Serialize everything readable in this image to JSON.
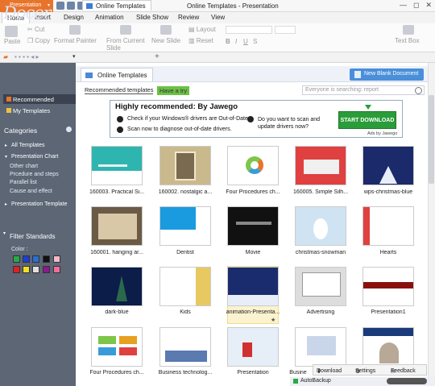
{
  "app": {
    "badge": "Presentation",
    "window_title": "Online Templates - Presentation"
  },
  "window_controls": [
    "—",
    "◻",
    "✕"
  ],
  "menu": [
    "Home",
    "Insert",
    "Design",
    "Animation",
    "Slide Show",
    "Review",
    "View"
  ],
  "ribbon": {
    "paste": "Paste",
    "cut": "Cut",
    "copy": "Copy",
    "format_painter": "Format Painter",
    "from_current_slide": "From Current Slide",
    "new_slide": "New Slide",
    "layout": "Layout",
    "reset": "Reset",
    "text_box": "Text Box"
  },
  "doc_tab": "Online Templates",
  "sidebar": {
    "logo": "Docer",
    "items": [
      {
        "label": "Recommended",
        "color": "#e8742b",
        "selected": true
      },
      {
        "label": "My Templates",
        "color": "#f0c040",
        "selected": false
      }
    ],
    "categories_title": "Categories",
    "categories": [
      {
        "label": "All Templates",
        "sub": []
      },
      {
        "label": "Presentation Chart",
        "sub": [
          "Other chart",
          "Prcedure and steps",
          "Parallel list",
          "Cause and effect"
        ]
      },
      {
        "label": "Presentation Template",
        "sub": []
      }
    ],
    "filter_title": "Filter Standards",
    "color_label": "Color :",
    "colors": [
      "#2aa84a",
      "#1f3fd0",
      "#2b6fcf",
      "#111111",
      "#f4b8c8",
      "#e02020",
      "#f0e020",
      "#e0e0e0",
      "#8a1a8a",
      "#f06e9a"
    ]
  },
  "content": {
    "tab_title": "Online Templates",
    "new_blank": "New Blank Document",
    "recommended_tab": "Recommended templates",
    "try_tab": "Have a try",
    "search_placeholder": "Everyone is searching: report"
  },
  "ad": {
    "title": "Highly recommended: By Jawego",
    "line1": "Check if your Windows® drivers are Out-of-Date.",
    "line2": "Scan now to diagnose out-of-date drivers.",
    "question": "Do you want to scan and update drivers now?",
    "button": "START DOWNLOAD",
    "by": "Ads by Jawego"
  },
  "templates": [
    {
      "caption": "160003. Practical Si...",
      "style": "teal"
    },
    {
      "caption": "160002. nostalgic a...",
      "style": "nostalgic"
    },
    {
      "caption": "Four Procedures ch...",
      "style": "ring"
    },
    {
      "caption": "160005. Simple Silh...",
      "style": "red"
    },
    {
      "caption": "wps-christmas-blue",
      "style": "xmasblue"
    },
    {
      "caption": "160001. hanging ar...",
      "style": "hanging"
    },
    {
      "caption": "Dentist",
      "style": "dentist"
    },
    {
      "caption": "Movie",
      "style": "movie"
    },
    {
      "caption": "christmas-snowman",
      "style": "snowman"
    },
    {
      "caption": "Hearts",
      "style": "hearts"
    },
    {
      "caption": "dark-blue",
      "style": "darkblue"
    },
    {
      "caption": "Kids",
      "style": "kids"
    },
    {
      "caption": "animation-Presenta...",
      "style": "anim"
    },
    {
      "caption": "Advertising",
      "style": "advert"
    },
    {
      "caption": "Presentation1",
      "style": "pres1"
    },
    {
      "caption": "Four Procedures ch...",
      "style": "procs"
    },
    {
      "caption": "Business technolog...",
      "style": "biztech"
    },
    {
      "caption": "Presentation",
      "style": "xmas2"
    },
    {
      "caption": "Busine",
      "style": "busine"
    },
    {
      "caption": "",
      "style": "people"
    }
  ],
  "bottom_actions": [
    "Download",
    "Settings",
    "Feedback"
  ],
  "status": {
    "autobackup": "AutoBackup"
  }
}
